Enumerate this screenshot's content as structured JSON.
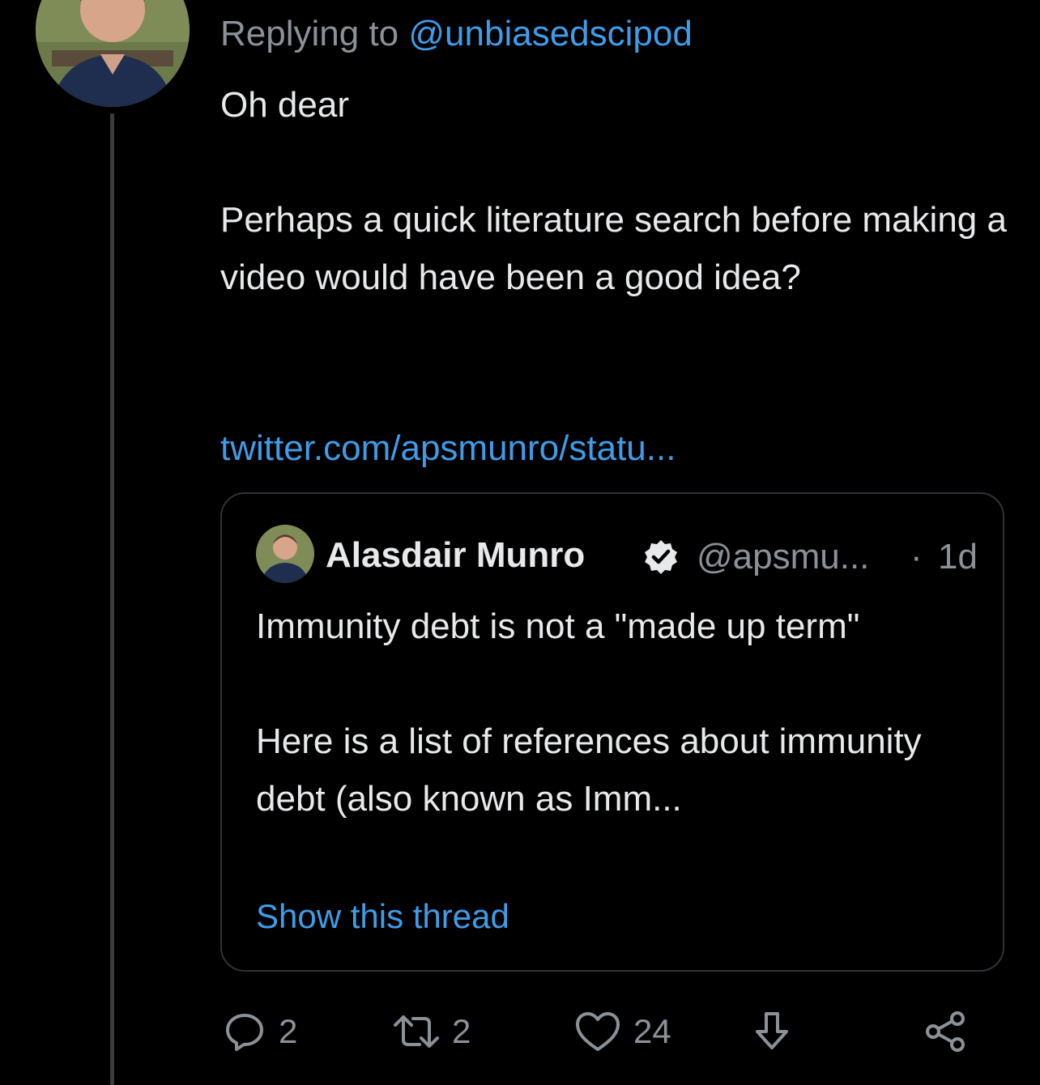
{
  "reply": {
    "prefix": "Replying to",
    "handle": "@unbiasedscipod"
  },
  "tweet": {
    "paragraphs": [
      "Oh dear",
      "Perhaps a quick literature search before making a video would have been a good idea?"
    ],
    "link": "twitter.com/apsmunro/statu..."
  },
  "quote": {
    "name": "Alasdair Munro",
    "handle": "@apsmu...",
    "separator": "·",
    "time": "1d",
    "paragraphs": [
      "Immunity debt is not a \"made up term\"",
      "Here is a list of references about immunity debt (also known as Imm..."
    ],
    "show_thread": "Show this thread"
  },
  "actions": {
    "reply_count": "2",
    "retweet_count": "2",
    "like_count": "24"
  },
  "icons": {
    "reply": "reply-icon",
    "retweet": "retweet-icon",
    "like": "heart-icon",
    "download": "download-icon",
    "share": "share-icon",
    "verified": "verified-badge-icon"
  },
  "colors": {
    "background": "#000000",
    "text": "#e7e9ea",
    "muted": "#8b9198",
    "link": "#3f9ce8",
    "border": "#2f3336"
  }
}
